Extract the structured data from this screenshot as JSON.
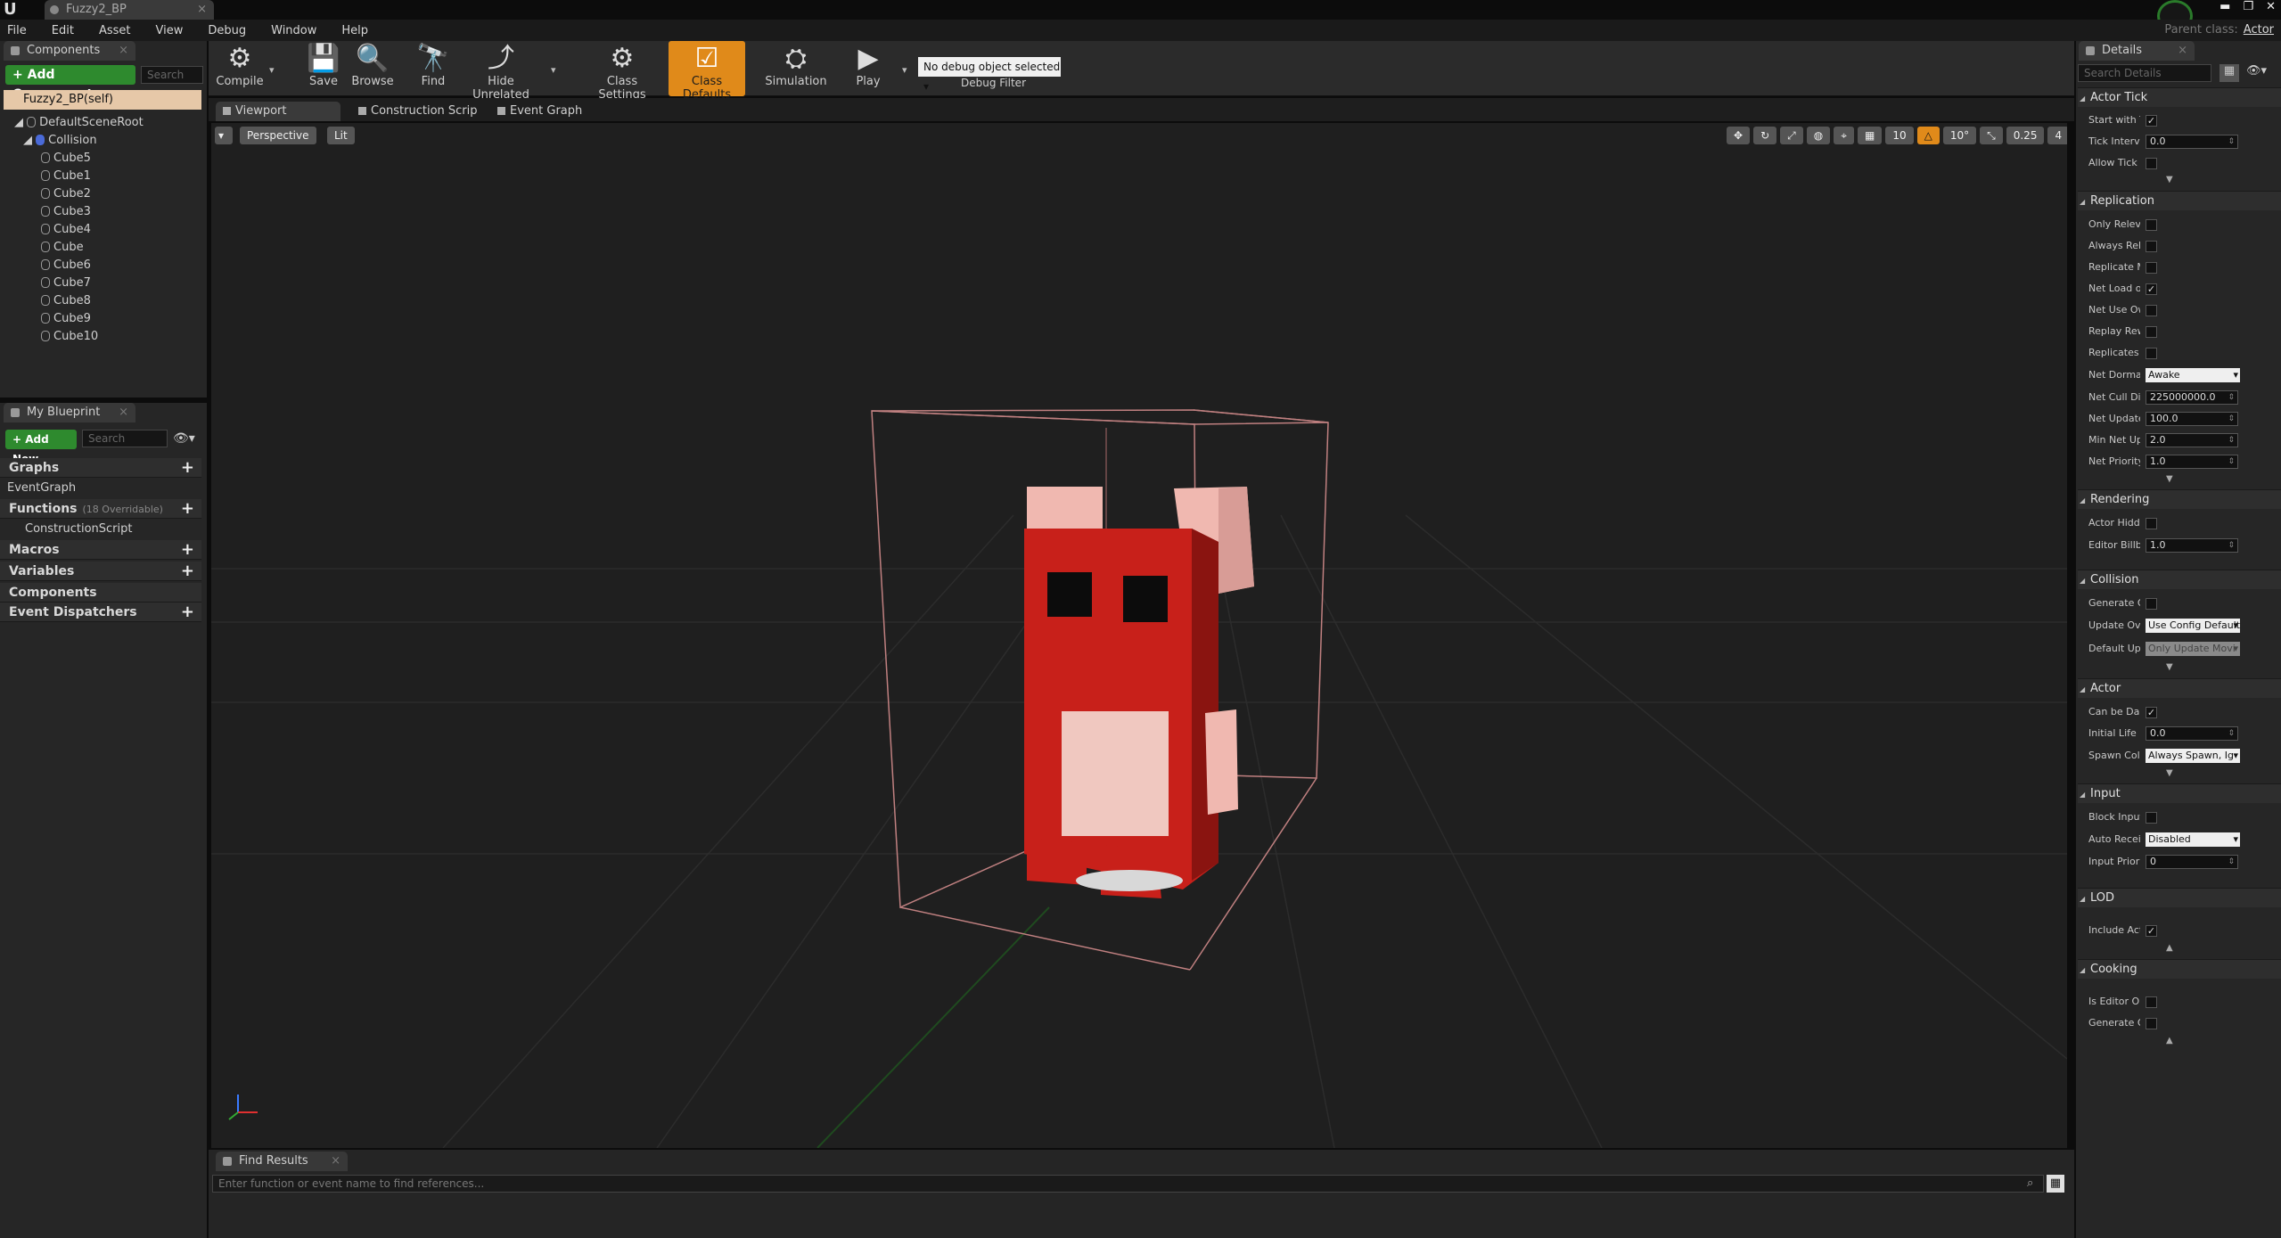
{
  "window": {
    "tab_title": "Fuzzy2_BP",
    "parent_class_label": "Parent class:",
    "parent_class_value": "Actor"
  },
  "menu": [
    "File",
    "Edit",
    "Asset",
    "View",
    "Debug",
    "Window",
    "Help"
  ],
  "components": {
    "tab": "Components",
    "add_button": "+ Add Component -",
    "search_placeholder": "Search",
    "self_item": "Fuzzy2_BP(self)",
    "root": "DefaultSceneRoot",
    "collision": "Collision",
    "children": [
      "Cube5",
      "Cube1",
      "Cube2",
      "Cube3",
      "Cube4",
      "Cube",
      "Cube6",
      "Cube7",
      "Cube8",
      "Cube9",
      "Cube10"
    ]
  },
  "my_blueprint": {
    "tab": "My Blueprint",
    "add_button": "+ Add New -",
    "search_placeholder": "Search",
    "graphs": "Graphs",
    "event_graph": "EventGraph",
    "functions": "Functions",
    "functions_note": "(18 Overridable)",
    "construction_script": "ConstructionScript",
    "macros": "Macros",
    "variables": "Variables",
    "components": "Components",
    "event_dispatchers": "Event Dispatchers"
  },
  "toolbar": {
    "compile": "Compile",
    "save": "Save",
    "browse": "Browse",
    "find": "Find",
    "hide_unrelated": "Hide Unrelated",
    "class_settings": "Class Settings",
    "class_defaults": "Class Defaults",
    "simulation": "Simulation",
    "play": "Play",
    "debug_select": "No debug object selected",
    "debug_filter": "Debug Filter"
  },
  "editor_tabs": [
    "Viewport",
    "Construction Scrip",
    "Event Graph"
  ],
  "viewport": {
    "perspective": "Perspective",
    "lit": "Lit",
    "grid_snap": "10",
    "rot_snap": "10°",
    "scale_snap": "0.25",
    "cam_speed": "4"
  },
  "find_results": {
    "tab": "Find Results",
    "placeholder": "Enter function or event name to find references..."
  },
  "details": {
    "tab": "Details",
    "search_placeholder": "Search Details",
    "sections": {
      "actor_tick": {
        "title": "Actor Tick",
        "start_with_tick": "Start with T",
        "tick_interval": "Tick Interv",
        "tick_interval_value": "0.0",
        "allow_tick": "Allow Tick I"
      },
      "replication": {
        "title": "Replication",
        "only_relevant": "Only Releva",
        "always_relevant": "Always Rele",
        "replicate_movement": "Replicate M",
        "net_load": "Net Load or",
        "net_use_owner": "Net Use Ow",
        "replay_rewind": "Replay Rew",
        "replicates": "Replicates",
        "net_dormancy": "Net Dorman",
        "net_dormancy_value": "Awake",
        "net_cull": "Net Cull Dis",
        "net_cull_value": "225000000.0",
        "net_update": "Net Update",
        "net_update_value": "100.0",
        "min_net_update": "Min Net Up",
        "min_net_update_value": "2.0",
        "net_priority": "Net Priority",
        "net_priority_value": "1.0"
      },
      "rendering": {
        "title": "Rendering",
        "actor_hidden": "Actor Hidde",
        "editor_billboard": "Editor Billbc",
        "editor_billboard_value": "1.0"
      },
      "collision": {
        "title": "Collision",
        "generate_overlap": "Generate O",
        "update_overlaps": "Update Ove",
        "update_overlaps_value": "Use Config Default",
        "default_update": "Default Upd",
        "default_update_value": "Only Update Movi"
      },
      "actor": {
        "title": "Actor",
        "can_be_damaged": "Can be Dan",
        "initial_life": "Initial Life S",
        "initial_life_value": "0.0",
        "spawn_collision": "Spawn Colli",
        "spawn_collision_value": "Always Spawn, Ig"
      },
      "input": {
        "title": "Input",
        "block_input": "Block Input",
        "auto_receive": "Auto Receiv",
        "auto_receive_value": "Disabled",
        "input_priority": "Input Priorit",
        "input_priority_value": "0"
      },
      "lod": {
        "title": "LOD",
        "include_actor": "Include Acti"
      },
      "cooking": {
        "title": "Cooking",
        "is_editor_only": "Is Editor On",
        "generate_optimized": "Generate O|"
      }
    }
  },
  "colors": {
    "accent_orange": "#e08a1a",
    "add_green": "#2e8a2e",
    "character_red": "#c8201a",
    "character_pink": "#f0b8b0"
  }
}
